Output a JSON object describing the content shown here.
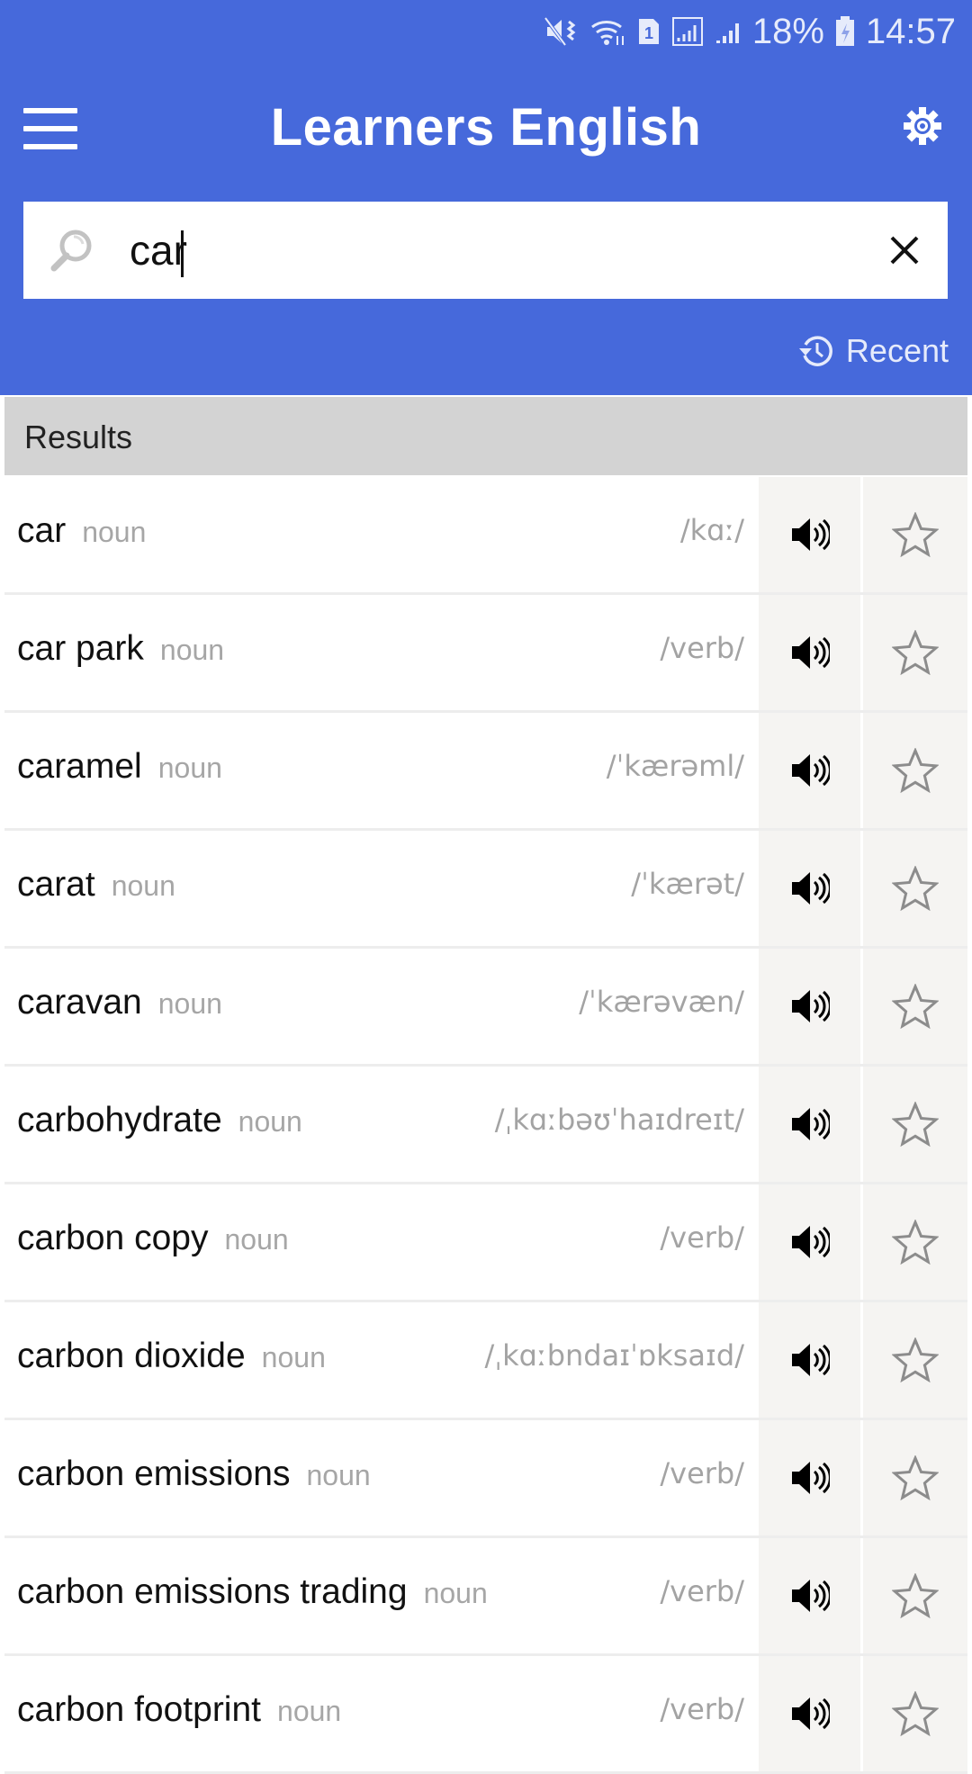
{
  "status_bar": {
    "icons": [
      "mute-vibrate-icon",
      "wifi-icon",
      "sim-1-icon",
      "signal-icon",
      "signal-icon"
    ],
    "sim_label": "1",
    "battery_percent": "18%",
    "time": "14:57"
  },
  "header": {
    "title": "Learners English",
    "menu_icon": "hamburger-icon",
    "settings_icon": "gear-icon"
  },
  "search": {
    "value": "car",
    "placeholder": "",
    "search_icon": "magnifier-icon",
    "clear_icon": "close-icon"
  },
  "recent": {
    "label": "Recent",
    "icon": "history-icon"
  },
  "results": {
    "heading": "Results",
    "items": [
      {
        "word": "car",
        "pos": "noun",
        "phonetic": "/kɑː/"
      },
      {
        "word": "car park",
        "pos": "noun",
        "phonetic": "/verb/"
      },
      {
        "word": "caramel",
        "pos": "noun",
        "phonetic": "/ˈkærəml/"
      },
      {
        "word": "carat",
        "pos": "noun",
        "phonetic": "/ˈkærət/"
      },
      {
        "word": "caravan",
        "pos": "noun",
        "phonetic": "/ˈkærəvæn/"
      },
      {
        "word": "carbohydrate",
        "pos": "noun",
        "phonetic": "/ˌkɑːbəʊˈhaɪdreɪt/"
      },
      {
        "word": "carbon copy",
        "pos": "noun",
        "phonetic": "/verb/"
      },
      {
        "word": "carbon dioxide",
        "pos": "noun",
        "phonetic": "/ˌkɑːbndaɪˈɒksaɪd/"
      },
      {
        "word": "carbon emissions",
        "pos": "noun",
        "phonetic": "/verb/"
      },
      {
        "word": "carbon emissions trading",
        "pos": "noun",
        "phonetic": "/verb/"
      },
      {
        "word": "carbon footprint",
        "pos": "noun",
        "phonetic": "/verb/"
      }
    ]
  },
  "colors": {
    "brand": "#4669db",
    "results_bar": "#d3d3d3",
    "action_cell": "#f5f4f2"
  }
}
